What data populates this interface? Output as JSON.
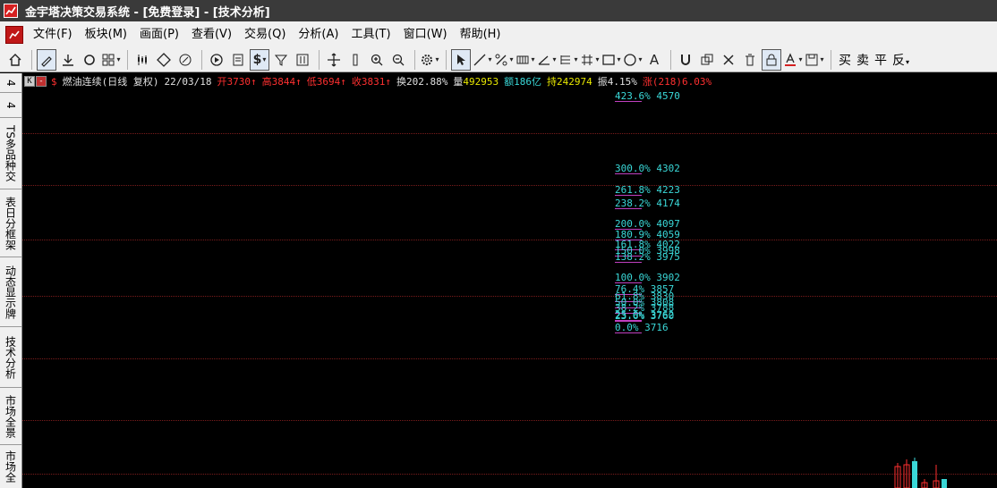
{
  "window": {
    "title": "金宇塔决策交易系统 - [免费登录] - [技术分析]"
  },
  "menu": [
    "文件(F)",
    "板块(M)",
    "画面(P)",
    "查看(V)",
    "交易(Q)",
    "分析(A)",
    "工具(T)",
    "窗口(W)",
    "帮助(H)"
  ],
  "toolbar": {
    "dollar_label": "$",
    "text_label": "A",
    "cn_buttons": [
      "买",
      "卖",
      "平",
      "反"
    ]
  },
  "sidebar": [
    "4",
    "4",
    "TS多品种交",
    "表日分框架",
    "动态显示牌",
    "技术分析",
    "市场全景",
    "市场全"
  ],
  "info": {
    "k_label": "K",
    "minus_label": "-",
    "dollar": "$",
    "symbol": "燃油连续(日线 复权)",
    "date": "22/03/18",
    "open": "开3730↑",
    "high": "高3844↑",
    "low": "低3694↑",
    "close": "收3831↑",
    "turnover": "换202.88%",
    "volume_label": "量",
    "volume_value": "492953",
    "amount": "额186亿",
    "hold_label": "持",
    "hold_value": "242974",
    "amplitude": "振4.15%",
    "change": "涨(218)6.03%"
  },
  "fib_levels": [
    {
      "pct": "423.6%",
      "price": "4570"
    },
    {
      "pct": "300.0%",
      "price": "4302"
    },
    {
      "pct": "261.8%",
      "price": "4223"
    },
    {
      "pct": "238.2%",
      "price": "4174"
    },
    {
      "pct": "200.0%",
      "price": "4097"
    },
    {
      "pct": "180.9%",
      "price": "4059"
    },
    {
      "pct": "161.8%",
      "price": "4022"
    },
    {
      "pct": "150.0%",
      "price": "3998"
    },
    {
      "pct": "138.2%",
      "price": "3975"
    },
    {
      "pct": "100.0%",
      "price": "3902"
    },
    {
      "pct": "76.4%",
      "price": "3857"
    },
    {
      "pct": "61.8%",
      "price": "3830"
    },
    {
      "pct": "50.0%",
      "price": "3808"
    },
    {
      "pct": "38.2%",
      "price": "3788"
    },
    {
      "pct": "25.0%",
      "price": "3762"
    },
    {
      "pct": "23.6%",
      "price": "3760"
    },
    {
      "pct": "0.0%",
      "price": "3716"
    }
  ],
  "colors": {
    "cyan": "#3ad8d8",
    "red": "#ff3030",
    "yellow": "#e8e800",
    "white": "#e0e0e0",
    "grid": "#7a1c1c"
  }
}
